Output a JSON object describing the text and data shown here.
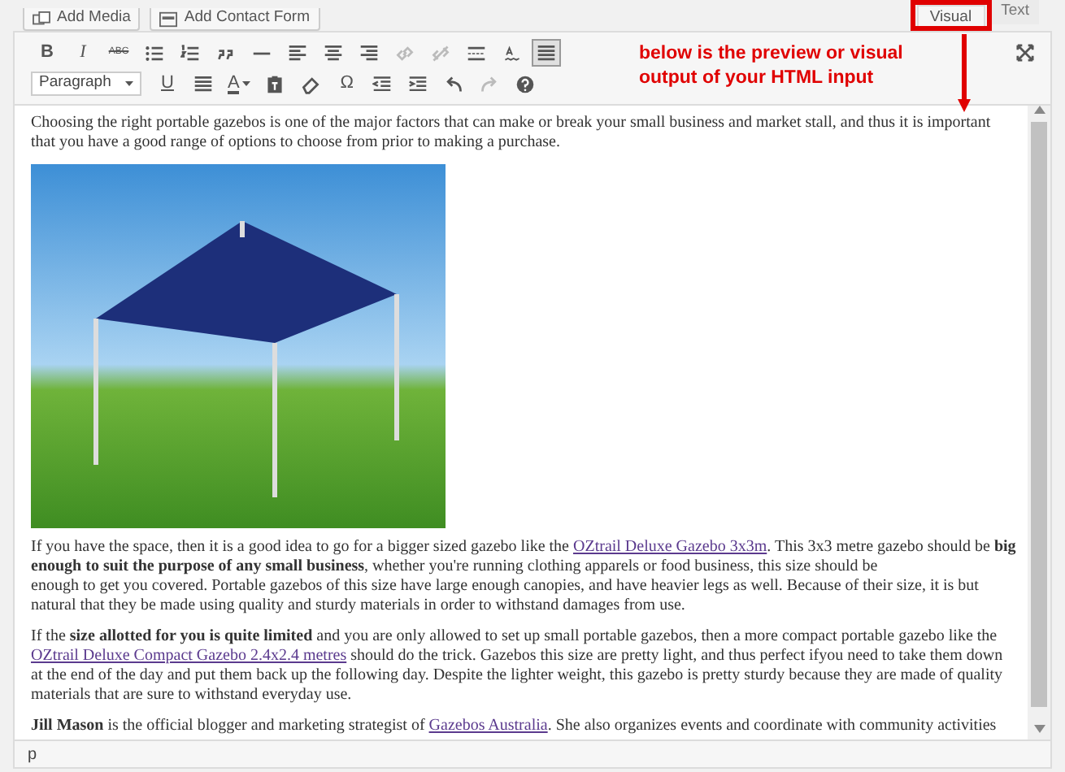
{
  "media_buttons": [
    {
      "label": "Add Media"
    },
    {
      "label": "Add Contact Form"
    }
  ],
  "tabs": [
    {
      "label": "Visual",
      "selected": true
    },
    {
      "label": "Text",
      "selected": false
    }
  ],
  "annotation": {
    "text": "below is the preview or visual\noutput of your HTML input"
  },
  "toolbar": {
    "row_1": [
      {
        "kind": "text",
        "label": "B",
        "disabled": false,
        "pressed": false
      },
      {
        "kind": "text",
        "label": "I",
        "disabled": false,
        "pressed": false
      },
      {
        "kind": "text",
        "label": "ABC",
        "disabled": false,
        "pressed": false
      },
      {
        "kind": "icon",
        "disabled": false,
        "pressed": false
      },
      {
        "kind": "icon",
        "disabled": false,
        "pressed": false
      },
      {
        "kind": "icon",
        "disabled": false,
        "pressed": false
      },
      {
        "kind": "icon",
        "disabled": false,
        "pressed": false
      },
      {
        "kind": "icon",
        "disabled": false,
        "pressed": false
      },
      {
        "kind": "icon",
        "disabled": false,
        "pressed": false
      },
      {
        "kind": "icon",
        "disabled": false,
        "pressed": false
      },
      {
        "kind": "icon",
        "disabled": true,
        "pressed": false
      },
      {
        "kind": "icon",
        "disabled": true,
        "pressed": false
      },
      {
        "kind": "icon",
        "disabled": false,
        "pressed": false
      },
      {
        "kind": "icon",
        "disabled": false,
        "pressed": false
      },
      {
        "kind": "icon",
        "disabled": false,
        "pressed": true
      }
    ],
    "format_select": {
      "value": "Paragraph"
    },
    "row_2": [
      {
        "kind": "text",
        "label": "U",
        "disabled": false,
        "pressed": false
      },
      {
        "kind": "icon",
        "disabled": false,
        "pressed": false
      },
      {
        "kind": "color",
        "label": "A",
        "disabled": false,
        "pressed": false
      },
      {
        "kind": "icon",
        "disabled": false,
        "pressed": false
      },
      {
        "kind": "icon",
        "disabled": false,
        "pressed": false
      },
      {
        "kind": "text",
        "label": "Ω",
        "disabled": false,
        "pressed": false
      },
      {
        "kind": "icon",
        "disabled": false,
        "pressed": false
      },
      {
        "kind": "icon",
        "disabled": false,
        "pressed": false
      },
      {
        "kind": "icon",
        "disabled": false,
        "pressed": false
      },
      {
        "kind": "icon",
        "disabled": true,
        "pressed": false
      },
      {
        "kind": "icon",
        "disabled": false,
        "pressed": false
      }
    ]
  },
  "content": [
    {
      "kind": "paragraph",
      "parts": [
        {
          "kind": "text",
          "text": "Choosing the right portable gazebos is one of the major factors that can make or break your small business and market stall, and thus it is important that you have a good range of options to choose from prior to making a purchase."
        }
      ]
    },
    {
      "kind": "photo"
    },
    {
      "kind": "paragraph",
      "parts": [
        {
          "kind": "text",
          "text": "If you have the space, then it is a good idea to go for a bigger sized gazebo like the "
        },
        {
          "kind": "link",
          "text": "OZtrail Deluxe Gazebo 3x3m"
        },
        {
          "kind": "text",
          "text": ". This 3x3 metre gazebo should be **big enough to suit the purpose of any small business**, whether you're running clothing apparels or food business, this size should be\nenough to get you covered. Portable gazebos of this size have large enough canopies, and have heavier legs as well. Because of their size, it is but natural that they be made using quality and sturdy materials in order to withstand damages from use."
        }
      ]
    },
    {
      "kind": "paragraph",
      "parts": [
        {
          "kind": "text",
          "text": "If the **size allotted for you is quite limited** and you are only allowed to set up small portable gazebos, then a more compact portable gazebo like the "
        },
        {
          "kind": "link",
          "text": "OZtrail Deluxe Compact Gazebo 2.4x2.4 metres"
        },
        {
          "kind": "text",
          "text": " should do the trick. Gazebos this size are pretty light, and thus perfect ifyou need to take them down at the end of the day and put them back up the following day. Despite the lighter weight, this gazebo is pretty sturdy because they are made of quality materials that are sure to withstand everyday use."
        }
      ]
    },
    {
      "kind": "paragraph",
      "parts": [
        {
          "kind": "text",
          "text": "**Jill Mason** is the official blogger and marketing strategist of "
        },
        {
          "kind": "link",
          "text": "Gazebos Australia"
        },
        {
          "kind": "text",
          "text": ". She also organizes events and coordinate with community activities"
        }
      ]
    }
  ],
  "status_bar": {
    "path": "p"
  }
}
